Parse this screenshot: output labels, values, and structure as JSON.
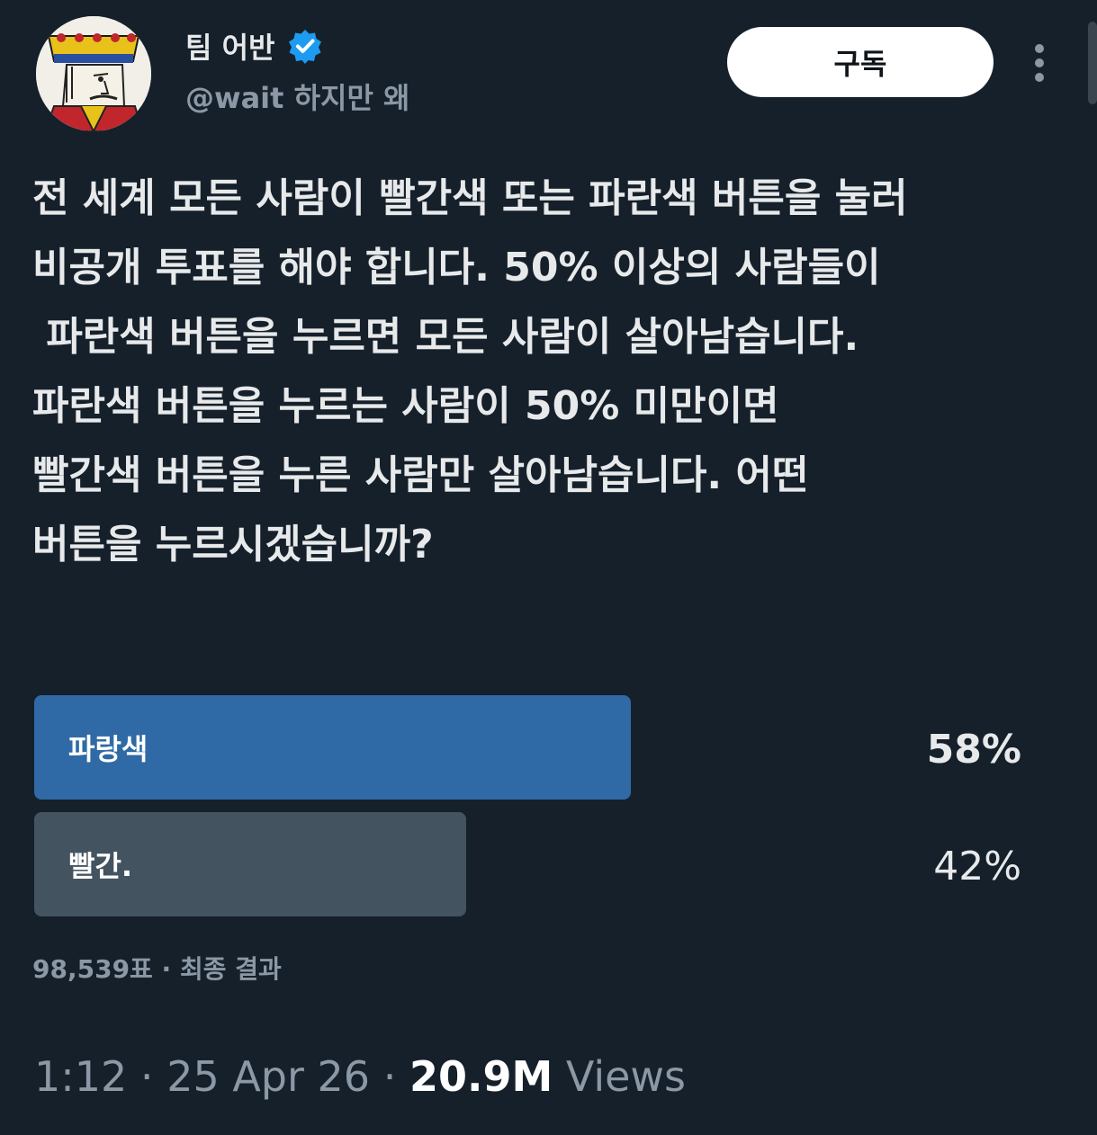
{
  "header": {
    "display_name": "팀 어반",
    "handle": "@wait 하지만 왜",
    "subscribe_label": "구독"
  },
  "tweet": {
    "lines": [
      "전 세계 모든 사람이 빨간색 또는 파란색 버튼을 눌러",
      "비공개 투표를 해야 합니다. 50% 이상의 사람들이",
      " 파란색 버튼을 누르면 모든 사람이 살아남습니다.",
      "파란색 버튼을 누르는 사람이 50% 미만이면",
      "빨간색 버튼을 누른 사람만 살아남습니다. 어떤",
      "버튼을 누르시겠습니까?"
    ]
  },
  "poll": {
    "options": [
      {
        "label": "파랑색",
        "percent_text": "58%",
        "share": 0.58,
        "color": "#2f6aa6"
      },
      {
        "label": "빨간.",
        "percent_text": "42%",
        "share": 0.42,
        "color": "#435360"
      }
    ],
    "votes": "98,539표",
    "separator": " · ",
    "status": "최종 결과"
  },
  "meta": {
    "time": "1:12",
    "sep": " · ",
    "date": "25 Apr 26",
    "views_count": "20.9M",
    "views_label": " Views"
  },
  "colors": {
    "background": "#15202b",
    "verified": "#1d9bf0",
    "muted": "#8b98a5"
  },
  "icons": {
    "verified": "verified-badge-icon",
    "more": "more-vertical-icon",
    "avatar": "king-card-avatar"
  }
}
